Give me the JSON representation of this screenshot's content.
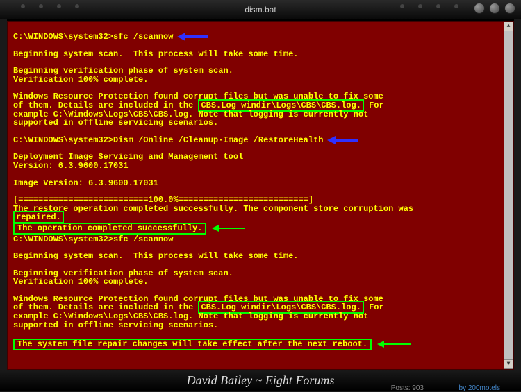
{
  "window": {
    "title": "dism.bat"
  },
  "terminal": {
    "prompt1": "C:\\WINDOWS\\system32>",
    "cmd1": "sfc /scannow",
    "begin_scan": "Beginning system scan.  This process will take some time.",
    "begin_verify": "Beginning verification phase of system scan.",
    "verify_complete": "Verification 100% complete.",
    "wrp1a": "Windows Resource Protection found corrupt files but was unable to fix some",
    "wrp1b": "of them. Details are included in the ",
    "cbs_box": "CBS.Log windir\\Logs\\CBS\\CBS.log.",
    "wrp1c": " For",
    "wrp1d": "example C:\\Windows\\Logs\\CBS\\CBS.log. Note that logging is currently not",
    "wrp1e": "supported in offline servicing scenarios.",
    "prompt2": "C:\\WINDOWS\\system32>",
    "cmd2": "Dism /Online /Cleanup-Image /RestoreHealth",
    "dism_tool": "Deployment Image Servicing and Management tool",
    "dism_ver": "Version: 6.3.9600.17031",
    "img_ver": "Image Version: 6.3.9600.17031",
    "progress": "[==========================100.0%==========================]",
    "restore_ok": "The restore operation completed successfully. The component store corruption was",
    "repaired": "repaired.",
    "op_complete": "The operation completed successfully.",
    "prompt3": "C:\\WINDOWS\\system32>",
    "cmd3": "sfc /scannow",
    "reboot_msg": "The system file repair changes will take effect after the next reboot."
  },
  "footer": {
    "watermark": "David Bailey ~ Eight Forums",
    "posts": "Posts: 903",
    "author": "by 200motels"
  }
}
